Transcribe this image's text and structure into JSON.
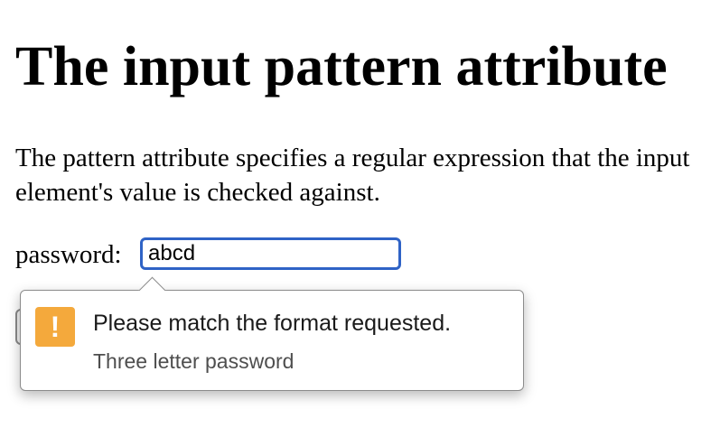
{
  "page": {
    "title": "The input pattern attribute",
    "description": "The pattern attribute specifies a regular expression that the input element's value is checked against."
  },
  "form": {
    "password_label": "password:",
    "password_value": "abcd"
  },
  "tooltip": {
    "icon": "warning-icon",
    "icon_glyph": "!",
    "icon_color": "#f4a93c",
    "message": "Please match the format requested.",
    "hint": "Three letter password"
  },
  "colors": {
    "focus_border": "#2f63c6"
  }
}
